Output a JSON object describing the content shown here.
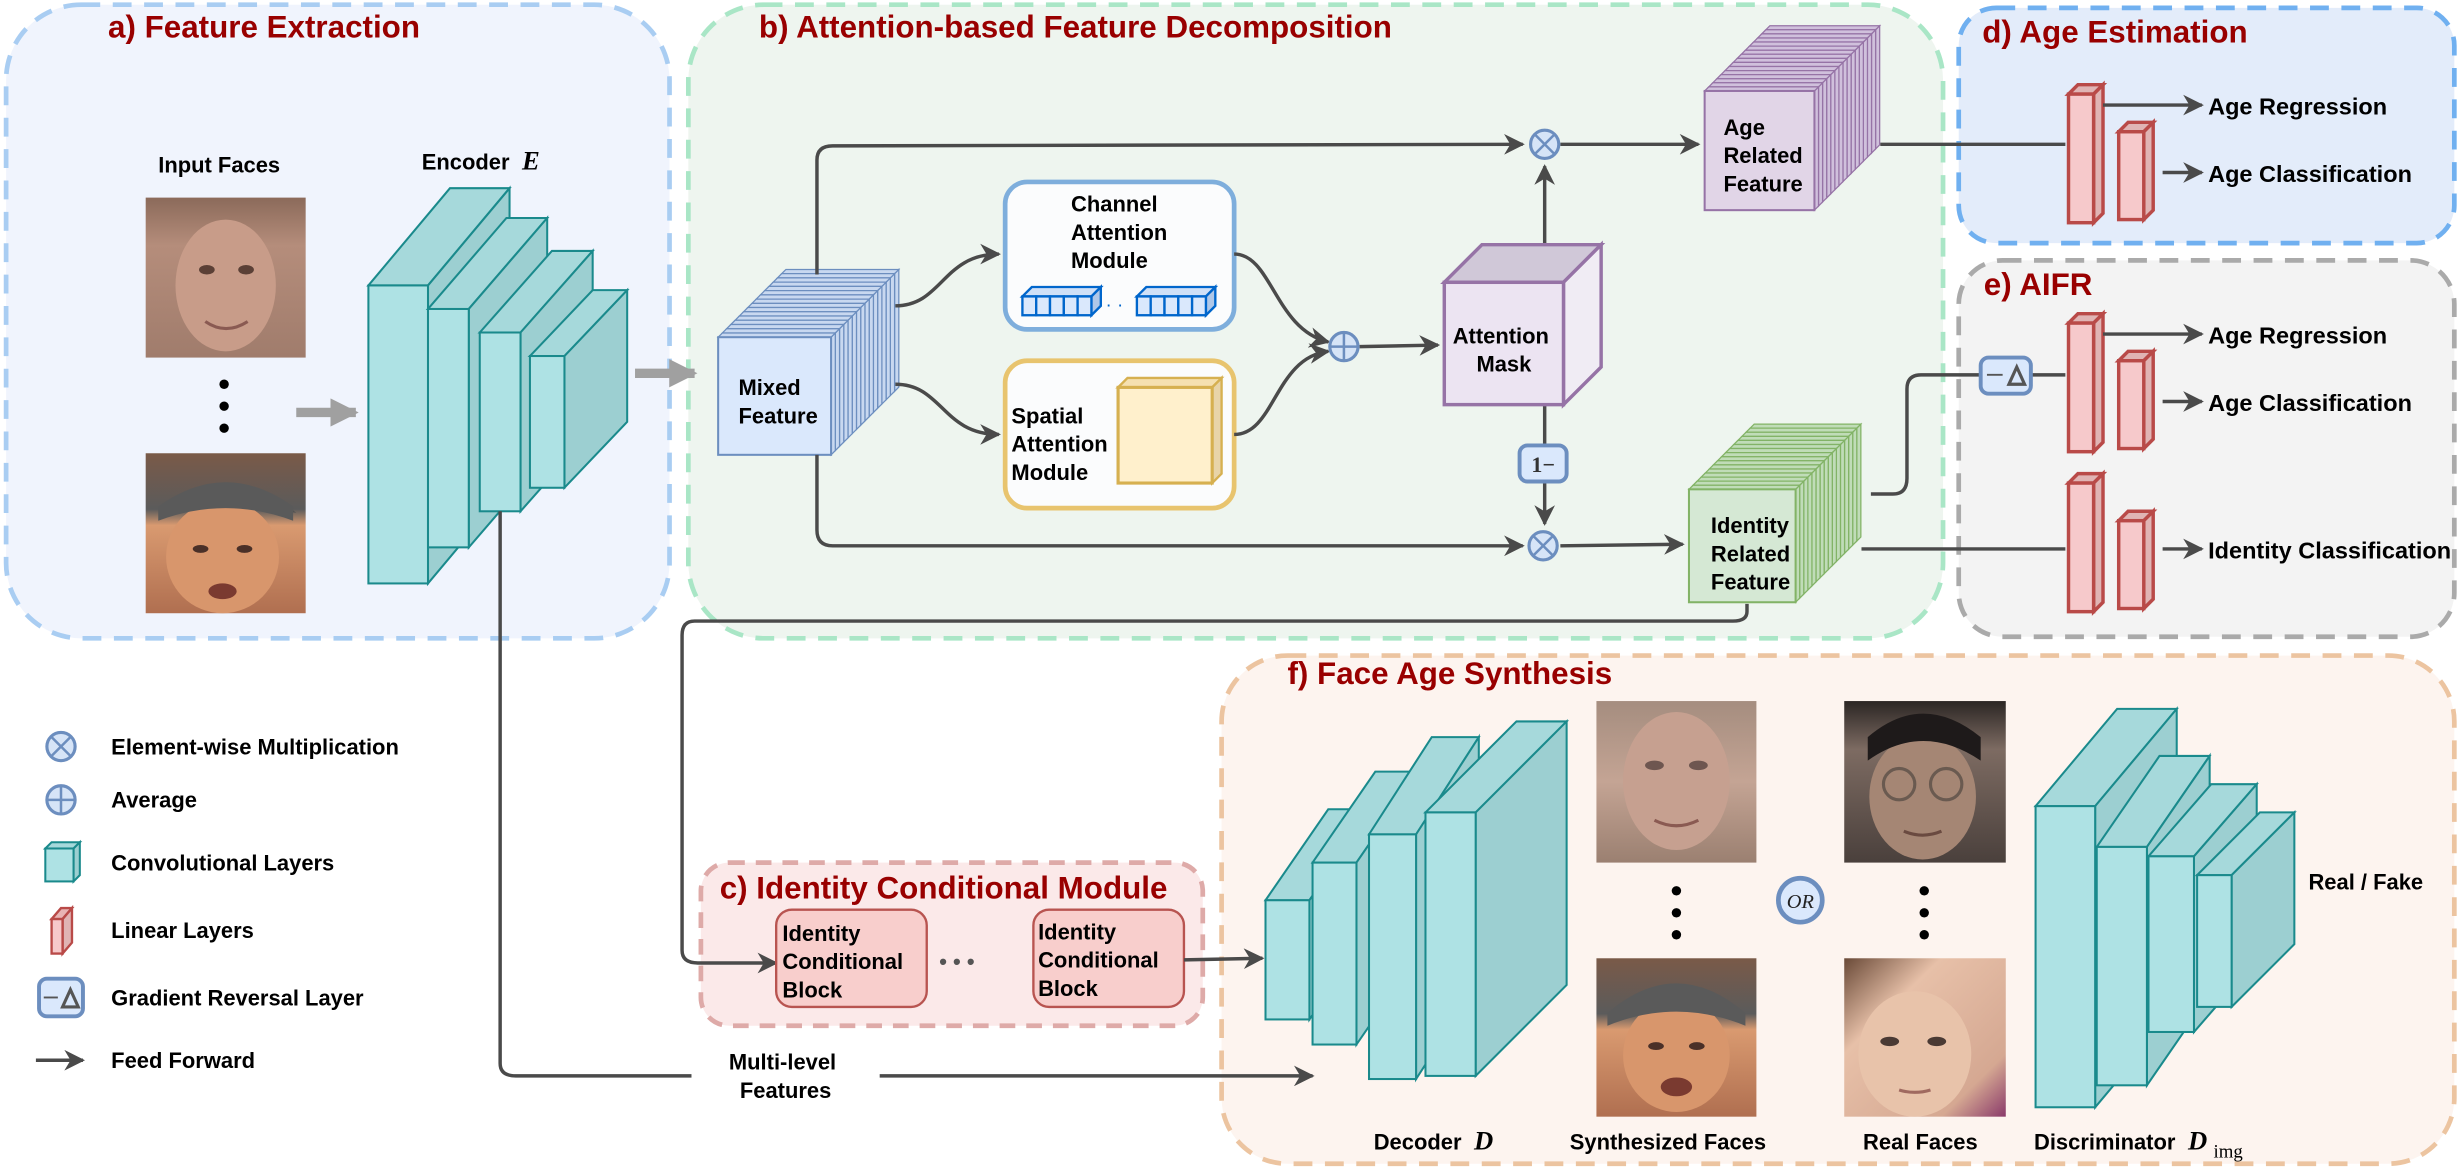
{
  "panels": {
    "a": {
      "title": "a) Feature Extraction",
      "input_faces_label": "Input Faces",
      "encoder_label": "Encoder",
      "encoder_symbol": "E"
    },
    "b": {
      "title": "b) Attention-based Feature Decomposition",
      "mixed_feature": [
        "Mixed",
        "Feature"
      ],
      "channel_attention": [
        "Channel",
        "Attention",
        "Module"
      ],
      "spatial_attention": [
        "Spatial",
        "Attention",
        "Module"
      ],
      "attention_mask": [
        "Attention",
        "Mask"
      ],
      "one_minus": "1−",
      "age_feature": [
        "Age",
        "Related",
        "Feature"
      ],
      "identity_feature": [
        "Identity",
        "Related",
        "Feature"
      ],
      "ellipsis": "· ·"
    },
    "c": {
      "title": "c) Identity Conditional Module",
      "block": [
        "Identity",
        "Conditional",
        "Block"
      ],
      "ellipsis": "• • •"
    },
    "d": {
      "title": "d) Age Estimation",
      "outputs": [
        "Age Regression",
        "Age Classification"
      ]
    },
    "e": {
      "title": "e) AIFR",
      "outputs": [
        "Age Regression",
        "Age Classification",
        "Identity Classification"
      ],
      "grl_symbol": "−Δ"
    },
    "f": {
      "title": "f) Face Age Synthesis",
      "decoder_label": "Decoder",
      "decoder_symbol": "D",
      "synth_label": "Synthesized Faces",
      "real_label": "Real Faces",
      "disc_label": "Discriminator",
      "disc_symbol": "D",
      "disc_sub": "img",
      "or_label": "OR",
      "real_fake": "Real / Fake"
    }
  },
  "multi_level": [
    "Multi-level",
    "Features"
  ],
  "legend": [
    {
      "icon": "element-wise-multiplication-icon",
      "label": "Element-wise Multiplication"
    },
    {
      "icon": "average-icon",
      "label": "Average"
    },
    {
      "icon": "convolutional-layer-icon",
      "label": "Convolutional Layers"
    },
    {
      "icon": "linear-layer-icon",
      "label": "Linear Layers"
    },
    {
      "icon": "gradient-reversal-icon",
      "label": "Gradient Reversal Layer"
    },
    {
      "icon": "arrow-icon",
      "label": "Feed Forward"
    }
  ],
  "colors": {
    "title": "#990000",
    "conv": "#aee2e4",
    "linear": "#f6c9cb",
    "age_feature": "#e1d5e7",
    "identity_feature": "#d5e8d4",
    "mixed_feature": "#dae8fc"
  }
}
